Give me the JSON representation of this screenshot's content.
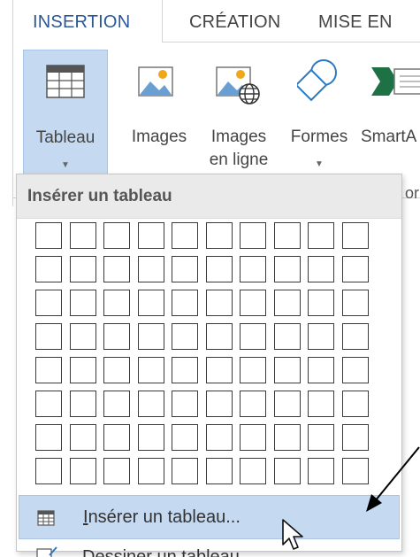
{
  "tabs": {
    "insertion": "INSERTION",
    "creation": "CRÉATION",
    "mise_en": "MISE EN"
  },
  "ribbon": {
    "tableau": {
      "label": "Tableau"
    },
    "images": {
      "label": "Images"
    },
    "images_en_ligne": {
      "label_line1": "Images",
      "label_line2": "en ligne"
    },
    "formes": {
      "label": "Formes"
    },
    "smartart": {
      "label": "SmartA"
    },
    "partial_text": "or"
  },
  "dropdown": {
    "title": "Insérer un tableau",
    "grid": {
      "columns": 10,
      "rows": 8
    },
    "menu": {
      "insert_table": {
        "label_underlined": "I",
        "label_rest": "nsérer un tableau..."
      },
      "draw_table": {
        "label": "Dessiner un tableau"
      }
    }
  },
  "colors": {
    "accent": "#2b579a",
    "highlight": "#c5d9f1",
    "grid_border": "#3a3a3a"
  },
  "icons": [
    "table-icon",
    "image-icon",
    "online-image-icon",
    "shapes-icon",
    "smartart-icon",
    "table-small-icon",
    "draw-table-icon",
    "pointer-icon",
    "annotation-arrow"
  ]
}
